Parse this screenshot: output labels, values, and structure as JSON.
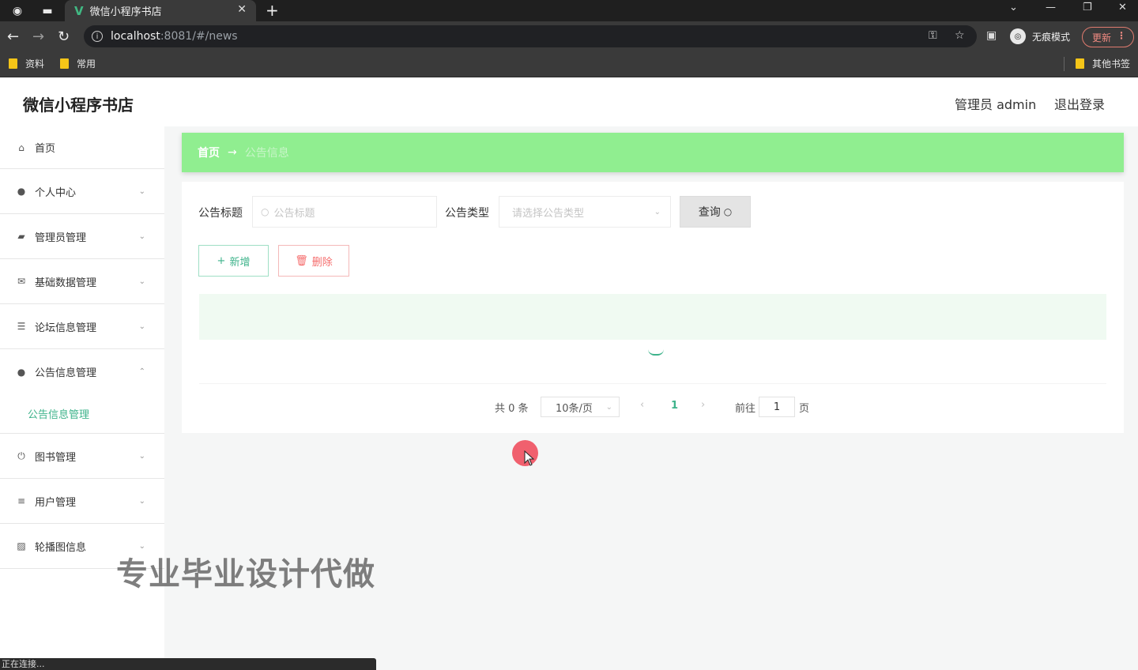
{
  "browser": {
    "tab_title": "微信小程序书店",
    "url_host": "localhost",
    "url_path": ":8081/#/news",
    "incognito_label": "无痕模式",
    "update_label": "更新",
    "bookmarks": [
      "资料",
      "常用"
    ],
    "other_bookmarks": "其他书签",
    "status_text": "正在连接..."
  },
  "header": {
    "title": "微信小程序书店",
    "user": "管理员 admin",
    "logout": "退出登录"
  },
  "sidebar": {
    "items": [
      {
        "label": "首页",
        "icon": "home-icon"
      },
      {
        "label": "个人中心",
        "icon": "user-icon"
      },
      {
        "label": "管理员管理",
        "icon": "wallet-icon"
      },
      {
        "label": "基础数据管理",
        "icon": "mail-icon"
      },
      {
        "label": "论坛信息管理",
        "icon": "list-icon"
      },
      {
        "label": "公告信息管理",
        "icon": "user-icon",
        "sub": "公告信息管理"
      },
      {
        "label": "图书管理",
        "icon": "power-icon"
      },
      {
        "label": "用户管理",
        "icon": "sliders-icon"
      },
      {
        "label": "轮播图信息",
        "icon": "picture-icon"
      }
    ]
  },
  "breadcrumb": {
    "home": "首页",
    "arrow": "→",
    "current": "公告信息"
  },
  "search": {
    "title_label": "公告标题",
    "title_placeholder": "公告标题",
    "type_label": "公告类型",
    "type_placeholder": "请选择公告类型",
    "query_label": "查询"
  },
  "actions": {
    "add_label": "新增",
    "delete_label": "删除"
  },
  "pagination": {
    "total": "共 0 条",
    "page_size": "10条/页",
    "current_page": "1",
    "goto_label": "前往",
    "goto_value": "1",
    "page_label": "页"
  },
  "watermark": "专业毕业设计代做"
}
